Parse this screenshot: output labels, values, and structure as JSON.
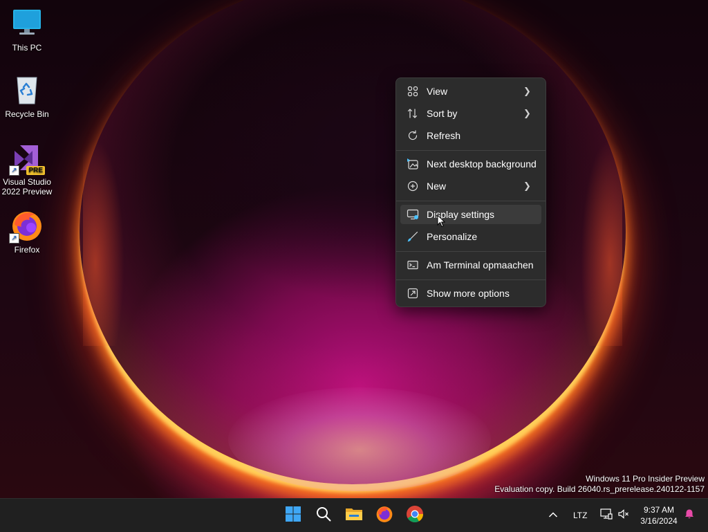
{
  "desktop": {
    "icons": [
      {
        "label": "This PC"
      },
      {
        "label": "Recycle Bin"
      },
      {
        "label": "Visual Studio 2022 Preview",
        "badge": "PRE"
      },
      {
        "label": "Firefox"
      }
    ]
  },
  "context_menu": {
    "items": [
      {
        "label": "View",
        "icon": "view-grid-icon",
        "submenu": true
      },
      {
        "label": "Sort by",
        "icon": "sort-icon",
        "submenu": true
      },
      {
        "label": "Refresh",
        "icon": "refresh-icon",
        "submenu": false
      },
      {
        "label": "Next desktop background",
        "icon": "next-background-icon",
        "submenu": false
      },
      {
        "label": "New",
        "icon": "new-plus-icon",
        "submenu": true
      },
      {
        "label": "Display settings",
        "icon": "display-settings-icon",
        "submenu": false,
        "highlighted": true
      },
      {
        "label": "Personalize",
        "icon": "personalize-brush-icon",
        "submenu": false
      },
      {
        "label": "Am Terminal opmaachen",
        "icon": "terminal-icon",
        "submenu": false
      },
      {
        "label": "Show more options",
        "icon": "more-options-icon",
        "submenu": false
      }
    ]
  },
  "watermark": {
    "line1": "Windows 11 Pro Insider Preview",
    "line2": "Evaluation copy. Build 26040.rs_prerelease.240122-1157"
  },
  "taskbar": {
    "apps": [
      "start-icon",
      "search-icon",
      "file-explorer-icon",
      "firefox-icon",
      "chrome-icon"
    ],
    "tray": {
      "language": "LTZ",
      "time": "9:37 AM",
      "date": "3/16/2024"
    }
  },
  "colors": {
    "menu_bg": "#2c2c2c",
    "menu_hover": "#3b3b3b",
    "taskbar_bg": "#202020",
    "start_blue": "#3fa7f5"
  }
}
